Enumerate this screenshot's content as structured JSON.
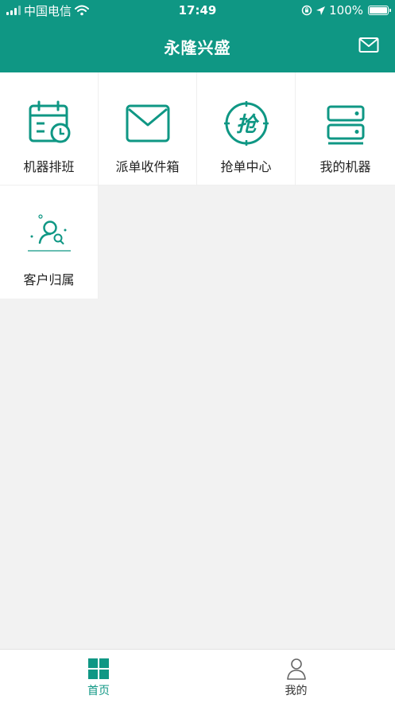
{
  "status_bar": {
    "carrier": "中国电信",
    "time": "17:49",
    "battery": "100%"
  },
  "header": {
    "title": "永隆兴盛"
  },
  "grid": {
    "items": [
      {
        "label": "机器排班",
        "icon": "calendar-clock-icon"
      },
      {
        "label": "派单收件箱",
        "icon": "envelope-icon"
      },
      {
        "label": "抢单中心",
        "icon": "grab-order-icon"
      },
      {
        "label": "我的机器",
        "icon": "server-icon"
      },
      {
        "label": "客户归属",
        "icon": "customer-search-icon"
      }
    ]
  },
  "tabbar": {
    "tabs": [
      {
        "label": "首页",
        "icon": "home-grid-icon",
        "active": true
      },
      {
        "label": "我的",
        "icon": "user-icon",
        "active": false
      }
    ]
  },
  "colors": {
    "brand": "#0f9784",
    "active_tab": "#0f9784",
    "inactive_tab": "#333333",
    "background": "#f2f2f2"
  }
}
